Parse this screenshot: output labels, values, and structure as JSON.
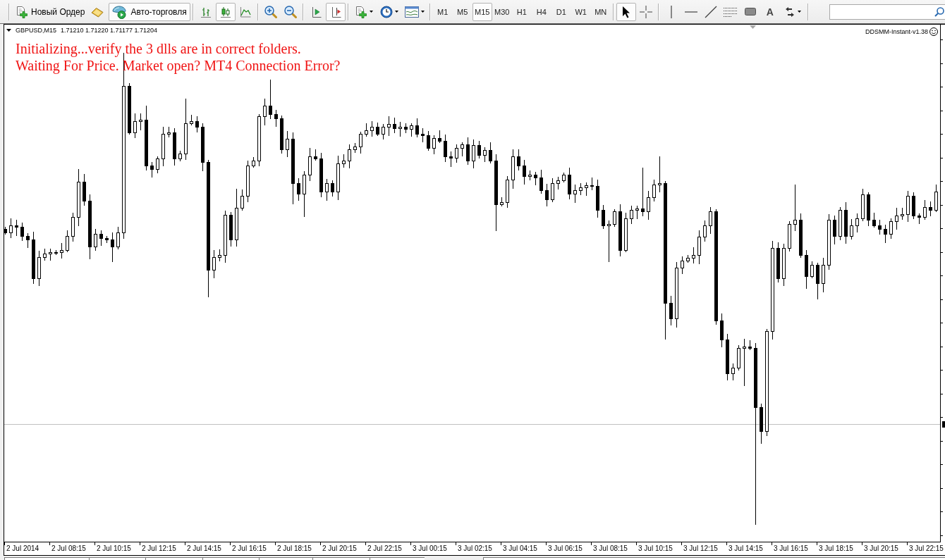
{
  "toolbar": {
    "new_order": {
      "label": "Новый Ордер"
    },
    "auto_trading": {
      "label": "Авто-торговля",
      "on": true
    },
    "chart_types": [
      {
        "kind": "bars",
        "selected": false
      },
      {
        "kind": "candles",
        "selected": true
      },
      {
        "kind": "line",
        "selected": false
      }
    ],
    "auto_scroll": {
      "on": false
    },
    "chart_shift": {
      "on": true
    },
    "timeframes": [
      {
        "label": "M1",
        "selected": false
      },
      {
        "label": "M5",
        "selected": false
      },
      {
        "label": "M15",
        "selected": true
      },
      {
        "label": "M30",
        "selected": false
      },
      {
        "label": "H1",
        "selected": false
      },
      {
        "label": "H4",
        "selected": false
      },
      {
        "label": "D1",
        "selected": false
      },
      {
        "label": "W1",
        "selected": false
      },
      {
        "label": "MN",
        "selected": false
      }
    ],
    "cursor_tools": [
      {
        "kind": "cursor",
        "selected": true
      },
      {
        "kind": "crosshair",
        "selected": false
      }
    ],
    "text_tool": {
      "label": "A"
    }
  },
  "chart": {
    "symbol": "GBPUSD,M15",
    "prices": "1.71210 1.71220 1.71177 1.71204",
    "messages": [
      "Initializing...verify the 3 dlls are in correct folders.",
      "Waiting For Price. Market open? MT4 Connection Error?"
    ],
    "expert": "DDSMM-Instant-v1.38",
    "time_axis": [
      "2 Jul 2014",
      "2 Jul 08:15",
      "2 Jul 10:15",
      "2 Jul 12:15",
      "2 Jul 14:15",
      "2 Jul 16:15",
      "2 Jul 18:15",
      "2 Jul 20:15",
      "2 Jul 22:15",
      "3 Jul 00:15",
      "3 Jul 02:15",
      "3 Jul 04:15",
      "3 Jul 06:15",
      "3 Jul 08:15",
      "3 Jul 10:15",
      "3 Jul 12:15",
      "3 Jul 14:15",
      "3 Jul 16:15",
      "3 Jul 18:15",
      "3 Jul 20:15",
      "3 Jul 22:15"
    ]
  }
}
